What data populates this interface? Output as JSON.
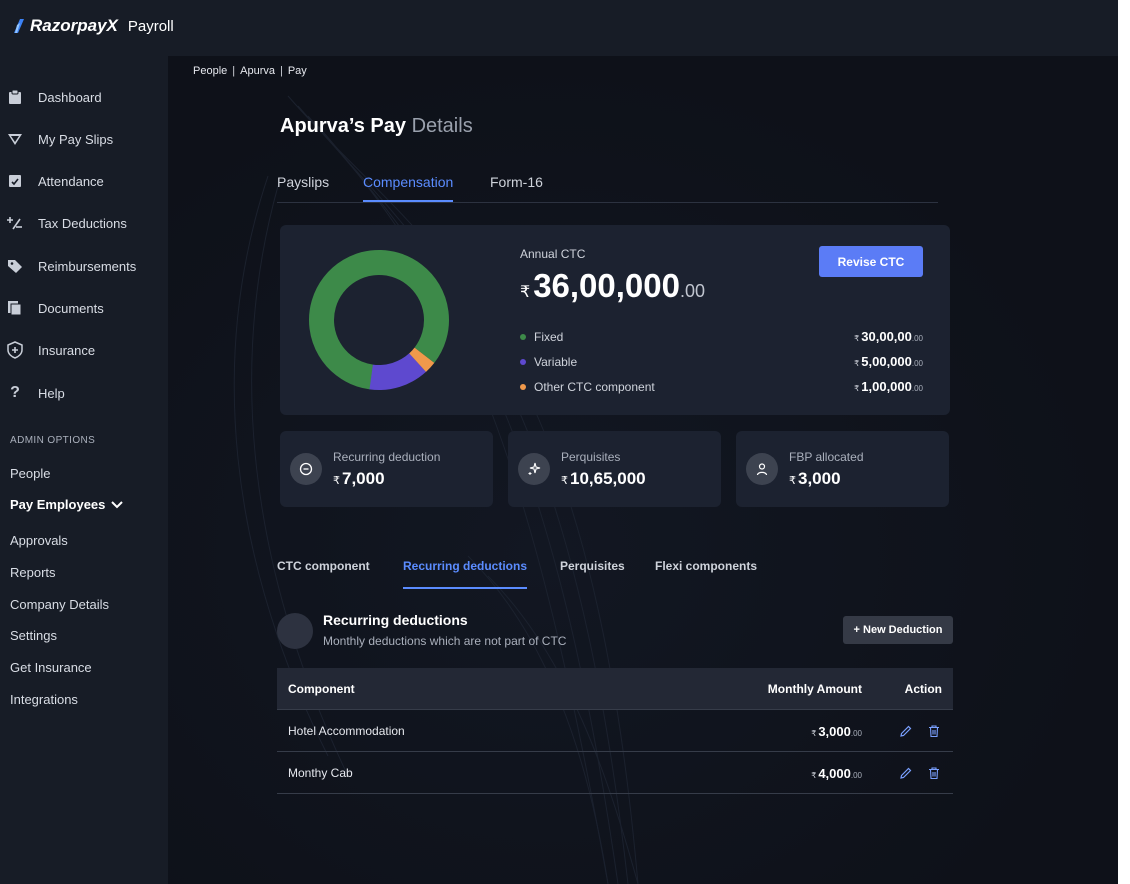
{
  "app": {
    "brand": "RazorpayX",
    "product": "Payroll"
  },
  "sidebar": {
    "items": [
      {
        "label": "Dashboard",
        "icon": "clipboard-icon"
      },
      {
        "label": "My Pay Slips",
        "icon": "paper-plane-icon"
      },
      {
        "label": "Attendance",
        "icon": "calendar-check-icon"
      },
      {
        "label": "Tax Deductions",
        "icon": "percent-icon"
      },
      {
        "label": "Reimbursements",
        "icon": "tag-icon"
      },
      {
        "label": "Documents",
        "icon": "documents-icon"
      },
      {
        "label": "Insurance",
        "icon": "shield-plus-icon"
      },
      {
        "label": "Help",
        "icon": "question-icon"
      }
    ],
    "admin_heading": "ADMIN OPTIONS",
    "admin_items": [
      "People",
      "Pay Employees",
      "Approvals",
      "Reports",
      "Company Details",
      "Settings",
      "Get Insurance",
      "Integrations"
    ]
  },
  "breadcrumb": [
    "People",
    "Apurva",
    "Pay"
  ],
  "page": {
    "title_strong": "Apurva’s Pay",
    "title_light": "Details"
  },
  "tabs": [
    "Payslips",
    "Compensation",
    "Form-16"
  ],
  "active_tab": "Compensation",
  "ctc": {
    "label": "Annual CTC",
    "currency": "₹",
    "amount": "36,00,000",
    "decimals": ".00",
    "revise_button": "Revise CTC",
    "breakdown": [
      {
        "name": "Fixed",
        "amount": "30,00,00",
        "decimals": ".00",
        "color": "#3d8a49"
      },
      {
        "name": "Variable",
        "amount": "5,00,000",
        "decimals": ".00",
        "color": "#5e49cf"
      },
      {
        "name": "Other CTC component",
        "amount": "1,00,000",
        "decimals": ".00",
        "color": "#f0994b"
      }
    ]
  },
  "chart_data": {
    "type": "pie",
    "categories": [
      "Fixed",
      "Variable",
      "Other CTC component"
    ],
    "values": [
      3000000,
      500000,
      100000
    ],
    "colors": [
      "#3d8a49",
      "#5e49cf",
      "#f0994b"
    ]
  },
  "stats": [
    {
      "label": "Recurring deduction",
      "currency": "₹",
      "value": "7,000",
      "icon": "minus-circle-icon"
    },
    {
      "label": "Perquisites",
      "currency": "₹",
      "value": "10,65,000",
      "icon": "sparkle-icon"
    },
    {
      "label": "FBP allocated",
      "currency": "₹",
      "value": "3,000",
      "icon": "person-icon"
    }
  ],
  "subtabs": [
    "CTC component",
    "Recurring deductions",
    "Perquisites",
    "Flexi components"
  ],
  "active_subtab": "Recurring deductions",
  "section": {
    "title": "Recurring deductions",
    "subtitle": "Monthly deductions which are not part of CTC",
    "new_button": "+ New Deduction"
  },
  "table": {
    "columns": [
      "Component",
      "Monthly Amount",
      "Action"
    ],
    "rows": [
      {
        "component": "Hotel Accommodation",
        "currency": "₹",
        "amount": "3,000",
        "decimals": ".00"
      },
      {
        "component": "Monthy Cab",
        "currency": "₹",
        "amount": "4,000",
        "decimals": ".00"
      }
    ]
  }
}
